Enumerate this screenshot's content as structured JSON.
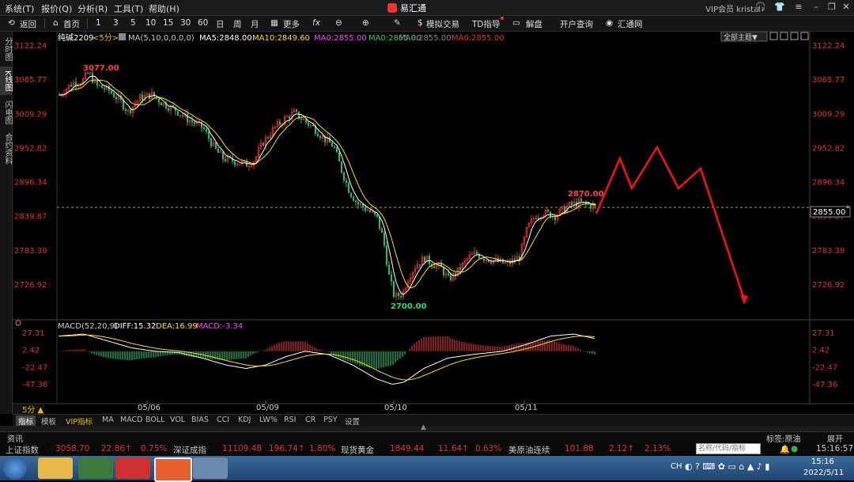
{
  "menubar": {
    "items": [
      "系统(T)",
      "报价(Q)",
      "分析(R)",
      "工具(T)",
      "帮助(H)"
    ],
    "app_title": "易汇通",
    "user": "VIP会员  kristal"
  },
  "toolbar": {
    "back": "返回",
    "home": "首页",
    "periods": [
      "1",
      "3",
      "5",
      "10",
      "15",
      "30",
      "60",
      "日",
      "周",
      "月"
    ],
    "more": "更多",
    "sim_trade": "模拟交易",
    "td_guide": "TD指导",
    "analysis": "解盘",
    "open_account": "开户查询",
    "huitong": "汇通网"
  },
  "left_tabs": [
    "分时图",
    "K线图",
    "闪电图",
    "合约资料"
  ],
  "chart": {
    "symbol": "纯碱2209",
    "period": "<5分>",
    "ma_legend": "MA(5,10,0,0,0,0)",
    "ma5": "MA5:2848.00",
    "ma10": "MA10:2849.60",
    "ma0a": "MA0:2855.00",
    "ma0b": "MA0:2855.00",
    "ma0c": "MA0:2855.00",
    "ma0d": "MA0:2855.00",
    "theme_btn": "全部主题▼",
    "price_ticks": [
      "3122.24",
      "3065.77",
      "3009.29",
      "2952.82",
      "2896.34",
      "2839.87",
      "2783.39",
      "2726.92"
    ],
    "current_price": "2855.00",
    "high_label": "3077.00",
    "low_label": "2700.00",
    "local_high_label": "2870.00",
    "macd_title": "MACD(52,20,9)",
    "diff": "DIFF:15.32",
    "dea": "DEA:16.99",
    "macd": "MACD:-3.34",
    "macd_ticks": [
      "27.31",
      "2.42",
      "-22.47",
      "-47.36"
    ],
    "dates": [
      "05/06",
      "05/09",
      "05/10",
      "05/11"
    ],
    "period_badge": "5分 ▲",
    "colors": {
      "up": "#e03030",
      "down": "#20c070",
      "ma5": "#ffffff",
      "ma10": "#ffe000",
      "macd_dea": "#ff40ff",
      "annotation": "#ff0000"
    }
  },
  "indicator_tabs": [
    "指标",
    "模板",
    "VIP指标",
    "MA",
    "MACD",
    "BOLL",
    "VOL",
    "BIAS",
    "CCI",
    "KDJ",
    "LW%",
    "RSI",
    "CR",
    "PSY",
    "设置"
  ],
  "infobar": {
    "left": "资讯",
    "right_label": "标签:原油",
    "expand": "展开"
  },
  "ticker": {
    "items": [
      {
        "name": "上证指数",
        "price": "3058.70",
        "chg": "22.86↑",
        "pct": "0.75%"
      },
      {
        "name": "深证成指",
        "price": "11109.48",
        "chg": "196.74↑",
        "pct": "1.80%"
      },
      {
        "name": "现货黄金",
        "price": "1849.44",
        "chg": "11.64↑",
        "pct": "0.63%"
      },
      {
        "name": "美原油连续",
        "price": "101.88",
        "chg": "2.12↑",
        "pct": "2.13%"
      }
    ],
    "search_placeholder": "名称/代码/指标",
    "time": "15:16:57"
  },
  "taskbar": {
    "time": "15:16",
    "date": "2022/5/11",
    "lang": "CH"
  }
}
